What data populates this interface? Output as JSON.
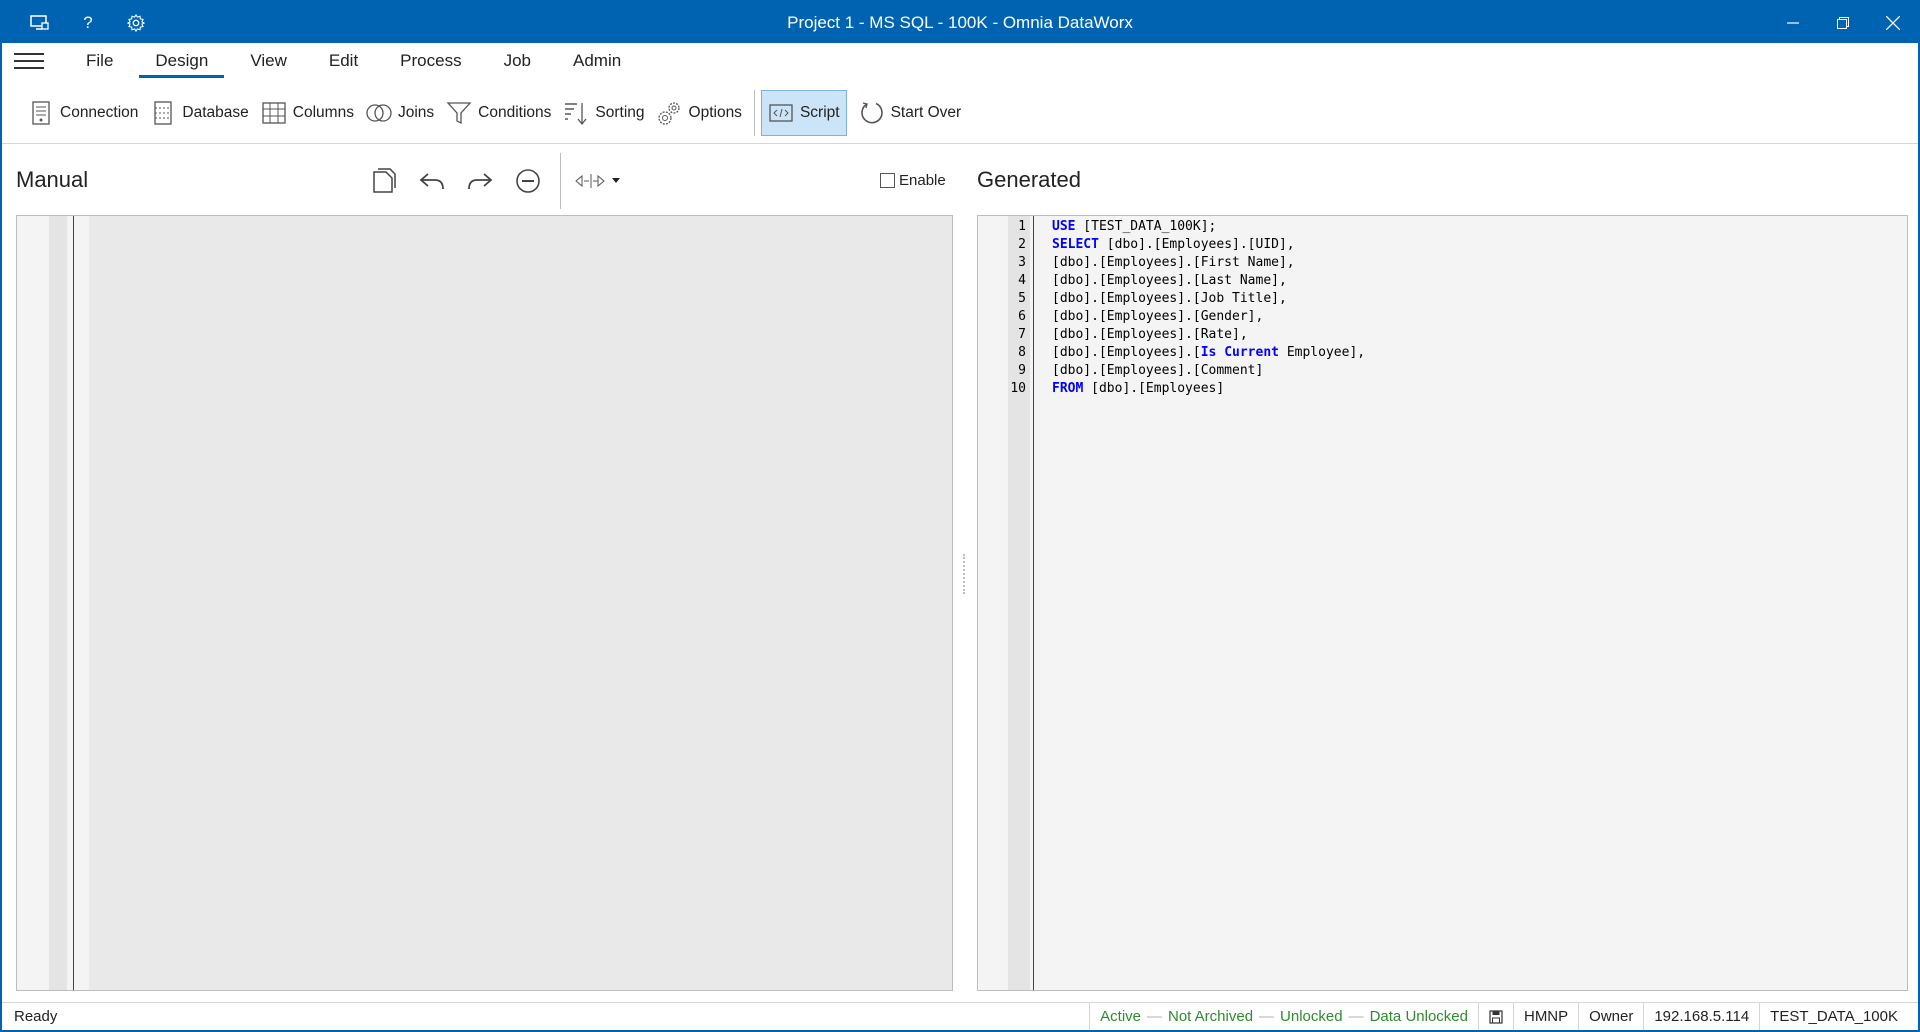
{
  "window": {
    "title": "Project 1 - MS SQL - 100K - Omnia DataWorx",
    "icons": [
      "display-icon",
      "help-icon",
      "settings-icon"
    ],
    "help_glyph": "?"
  },
  "menu": {
    "items": [
      "File",
      "Design",
      "View",
      "Edit",
      "Process",
      "Job",
      "Admin"
    ],
    "active": "Design"
  },
  "ribbon": {
    "connection": "Connection",
    "database": "Database",
    "columns": "Columns",
    "joins": "Joins",
    "conditions": "Conditions",
    "sorting": "Sorting",
    "options": "Options",
    "script": "Script",
    "start_over": "Start Over"
  },
  "manual": {
    "title": "Manual",
    "enable_label": "Enable",
    "enable_checked": false
  },
  "generated": {
    "title": "Generated",
    "lines": [
      {
        "n": "1",
        "kw": "USE",
        "rest": " [TEST_DATA_100K];"
      },
      {
        "n": "2",
        "kw": "SELECT",
        "rest": " [dbo].[Employees].[UID],"
      },
      {
        "n": "3",
        "kw": "",
        "rest": "[dbo].[Employees].[First Name],"
      },
      {
        "n": "4",
        "kw": "",
        "rest": "[dbo].[Employees].[Last Name],"
      },
      {
        "n": "5",
        "kw": "",
        "rest": "[dbo].[Employees].[Job Title],"
      },
      {
        "n": "6",
        "kw": "",
        "rest": "[dbo].[Employees].[Gender],"
      },
      {
        "n": "7",
        "kw": "",
        "rest": "[dbo].[Employees].[Rate],"
      },
      {
        "n": "8",
        "kw": "",
        "rest": "[dbo].[Employees].[",
        "kw2": "Is Current",
        "rest2": " Employee],"
      },
      {
        "n": "9",
        "kw": "",
        "rest": "[dbo].[Employees].[Comment]"
      },
      {
        "n": "10",
        "kw": "FROM",
        "rest": " [dbo].[Employees]"
      }
    ]
  },
  "status": {
    "ready": "Ready",
    "active": "Active",
    "archived": "Not Archived",
    "locked": "Unlocked",
    "data_locked": "Data Unlocked",
    "user": "HMNP",
    "role": "Owner",
    "ip": "192.168.5.114",
    "database": "TEST_DATA_100K",
    "dash": "—",
    "green_color": "#2e8b2e"
  }
}
